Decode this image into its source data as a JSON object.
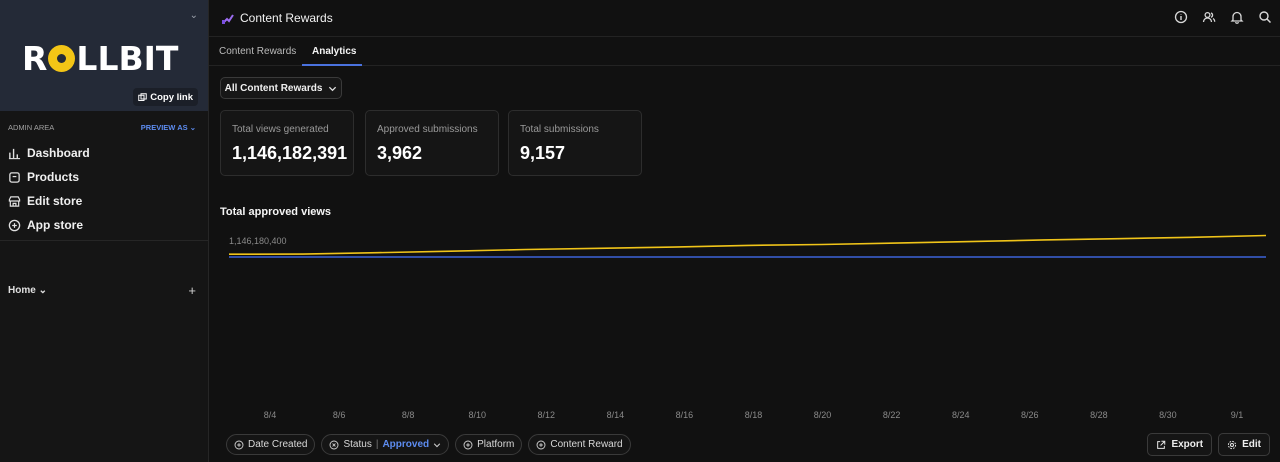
{
  "brand": {
    "logo_text_left": "R",
    "logo_text_right": "LLBIT",
    "copy_link": "Copy link"
  },
  "sidebar": {
    "admin_label": "ADMIN AREA",
    "preview_as": "PREVIEW AS",
    "items": [
      {
        "label": "Dashboard",
        "icon": "chart-icon"
      },
      {
        "label": "Products",
        "icon": "box-icon"
      },
      {
        "label": "Edit store",
        "icon": "store-icon"
      },
      {
        "label": "App store",
        "icon": "plus-circle-icon"
      }
    ],
    "home_label": "Home",
    "add_label": "+"
  },
  "topbar": {
    "title": "Content Rewards"
  },
  "tabs": [
    {
      "label": "Content Rewards"
    },
    {
      "label": "Analytics"
    }
  ],
  "filter": {
    "label": "All Content Rewards"
  },
  "stats": [
    {
      "label": "Total views generated",
      "value": "1,146,182,391"
    },
    {
      "label": "Approved submissions",
      "value": "3,962"
    },
    {
      "label": "Total submissions",
      "value": "9,157"
    }
  ],
  "chart_title": "Total approved views",
  "chart_data": {
    "type": "line",
    "categories": [
      "8/4",
      "8/6",
      "8/8",
      "8/10",
      "8/12",
      "8/14",
      "8/16",
      "8/18",
      "8/20",
      "8/22",
      "8/24",
      "8/26",
      "8/28",
      "8/30",
      "9/1"
    ],
    "y_label_shown": "1,146,180,400",
    "series": [
      {
        "color": "#f0c419",
        "values": [
          0.95,
          1.0,
          1.5,
          2.0,
          2.6,
          3.0,
          3.4,
          4.0,
          4.3,
          4.8,
          5.3,
          5.9,
          6.3,
          6.8,
          7.4
        ]
      },
      {
        "color": "#3c63d8",
        "values": [
          0,
          0,
          0,
          0,
          0,
          0,
          0,
          0,
          0,
          0,
          0,
          0,
          0,
          0,
          0
        ]
      }
    ],
    "ylim": [
      -50,
      10
    ]
  },
  "filters": [
    {
      "label": "Date Created"
    },
    {
      "label": "Status",
      "value": "Approved"
    },
    {
      "label": "Platform"
    },
    {
      "label": "Content Reward"
    }
  ],
  "actions": {
    "export": "Export",
    "edit": "Edit"
  },
  "colors": {
    "accent": "#4a72df",
    "yellow": "#f0c419",
    "sidebar_header": "#242a37"
  }
}
